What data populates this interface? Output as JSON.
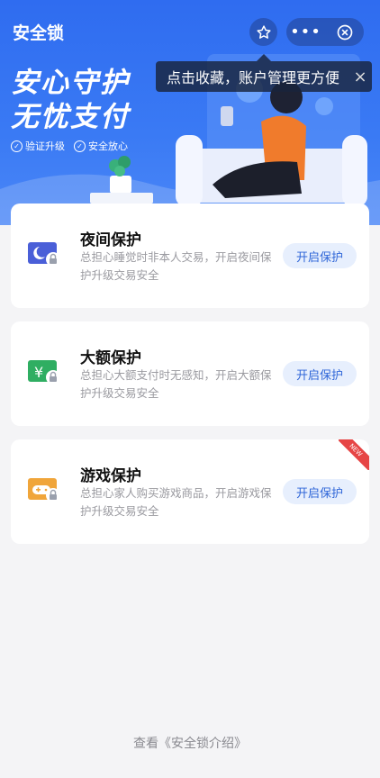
{
  "header": {
    "title": "安全锁",
    "star_icon": "star-icon",
    "more_icon": "more-icon",
    "close_icon": "close-circle-icon"
  },
  "tooltip": {
    "text": "点击收藏，账户管理更方便",
    "close": "×"
  },
  "banner": {
    "slogan_line1": "安心守护",
    "slogan_line2": "无忧支付",
    "badges": [
      "验证升级",
      "安全放心"
    ]
  },
  "cards": [
    {
      "name": "夜间保护",
      "desc": "总担心睡觉时非本人交易，开启夜间保护升级交易安全",
      "button": "开启保护",
      "icon": "moon-lock-icon",
      "color": "#4a5fd8"
    },
    {
      "name": "大额保护",
      "desc": "总担心大额支付时无感知，开启大额保护升级交易安全",
      "button": "开启保护",
      "icon": "yuan-lock-icon",
      "color": "#2fae62"
    },
    {
      "name": "游戏保护",
      "desc": "总担心家人购买游戏商品，开启游戏保护升级交易安全",
      "button": "开启保护",
      "icon": "gamepad-lock-icon",
      "color": "#f0a53a",
      "tag": "NEW"
    }
  ],
  "footer": {
    "prefix": "查看",
    "link": "《安全锁介绍》"
  }
}
